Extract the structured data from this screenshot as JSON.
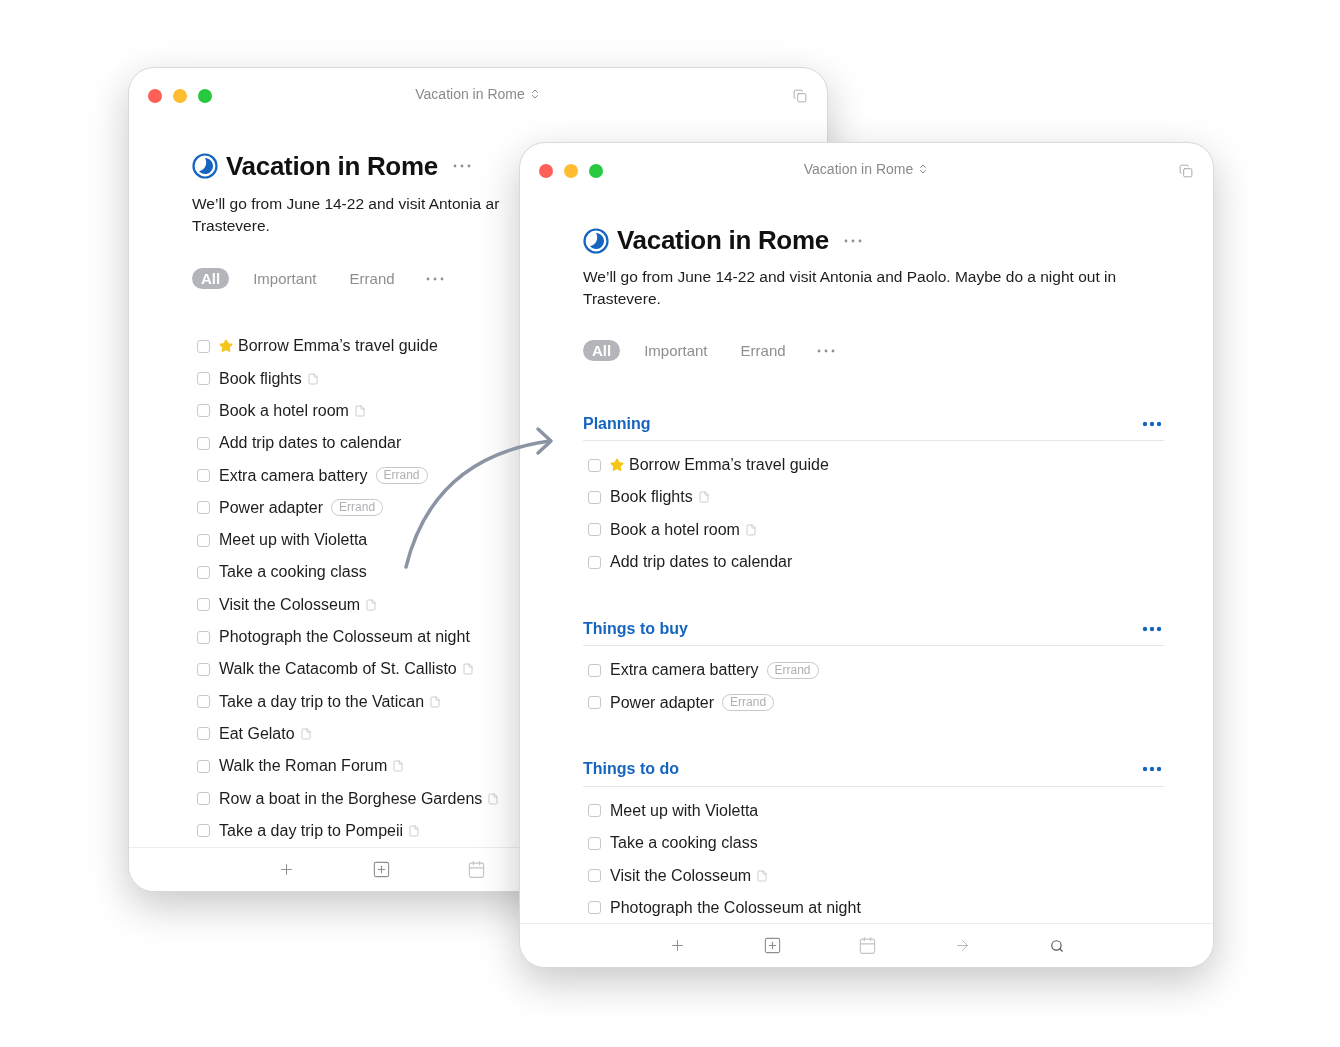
{
  "windows": [
    {
      "title": "Vacation in Rome",
      "heading": "Vacation in Rome",
      "description": "We’ll go from June 14-22 and visit Antonia ar\nTrastevere.",
      "tabs": [
        {
          "label": "All",
          "selected": true
        },
        {
          "label": "Important",
          "selected": false
        },
        {
          "label": "Errand",
          "selected": false
        }
      ],
      "items": [
        {
          "text": "Borrow Emma’s travel guide",
          "checked": false,
          "starred": true
        },
        {
          "text": "Book flights",
          "checked": false,
          "note": true
        },
        {
          "text": "Book a hotel room",
          "checked": false,
          "note": true
        },
        {
          "text": "Add trip dates to calendar",
          "checked": false
        },
        {
          "text": "Extra camera battery",
          "checked": false,
          "tag": "Errand"
        },
        {
          "text": "Power adapter",
          "checked": false,
          "tag": "Errand"
        },
        {
          "text": "Meet up with Violetta",
          "checked": false
        },
        {
          "text": "Take a cooking class",
          "checked": false
        },
        {
          "text": "Visit the Colosseum",
          "checked": false,
          "note": true
        },
        {
          "text": "Photograph the Colosseum at night",
          "checked": false
        },
        {
          "text": "Walk the Catacomb of St. Callisto",
          "checked": false,
          "note": true
        },
        {
          "text": "Take a day trip to the Vatican",
          "checked": false,
          "note": true
        },
        {
          "text": "Eat Gelato",
          "checked": false,
          "note": true
        },
        {
          "text": "Walk the Roman Forum",
          "checked": false,
          "note": true
        },
        {
          "text": "Row a boat in the Borghese Gardens",
          "checked": false,
          "note": true
        },
        {
          "text": "Take a day trip to Pompeii",
          "checked": false,
          "note": true
        }
      ],
      "toolbar": [
        {
          "kind": "plus"
        },
        {
          "kind": "add"
        },
        {
          "kind": "calendar"
        }
      ]
    },
    {
      "title": "Vacation in Rome",
      "heading": "Vacation in Rome",
      "description": "We’ll go from June 14-22 and visit Antonia and Paolo. Maybe do a night out in\nTrastevere.",
      "tabs": [
        {
          "label": "All",
          "selected": true
        },
        {
          "label": "Important",
          "selected": false
        },
        {
          "label": "Errand",
          "selected": false
        }
      ],
      "sections": [
        {
          "title": "Planning",
          "items": [
            {
              "text": "Borrow Emma’s travel guide",
              "checked": false,
              "starred": true
            },
            {
              "text": "Book flights",
              "checked": false,
              "note": true
            },
            {
              "text": "Book a hotel room",
              "checked": false,
              "note": true
            },
            {
              "text": "Add trip dates to calendar",
              "checked": false
            }
          ]
        },
        {
          "title": "Things to buy",
          "items": [
            {
              "text": "Extra camera battery",
              "checked": false,
              "tag": "Errand"
            },
            {
              "text": "Power adapter",
              "checked": false,
              "tag": "Errand"
            }
          ]
        },
        {
          "title": "Things to do",
          "items": [
            {
              "text": "Meet up with Violetta",
              "checked": false
            },
            {
              "text": "Take a cooking class",
              "checked": false
            },
            {
              "text": "Visit the Colosseum",
              "checked": false,
              "note": true
            },
            {
              "text": "Photograph the Colosseum at night",
              "checked": false
            }
          ]
        }
      ],
      "toolbar": [
        {
          "kind": "plus"
        },
        {
          "kind": "add"
        },
        {
          "kind": "calendar"
        },
        {
          "kind": "forward"
        },
        {
          "kind": "search"
        }
      ]
    }
  ]
}
